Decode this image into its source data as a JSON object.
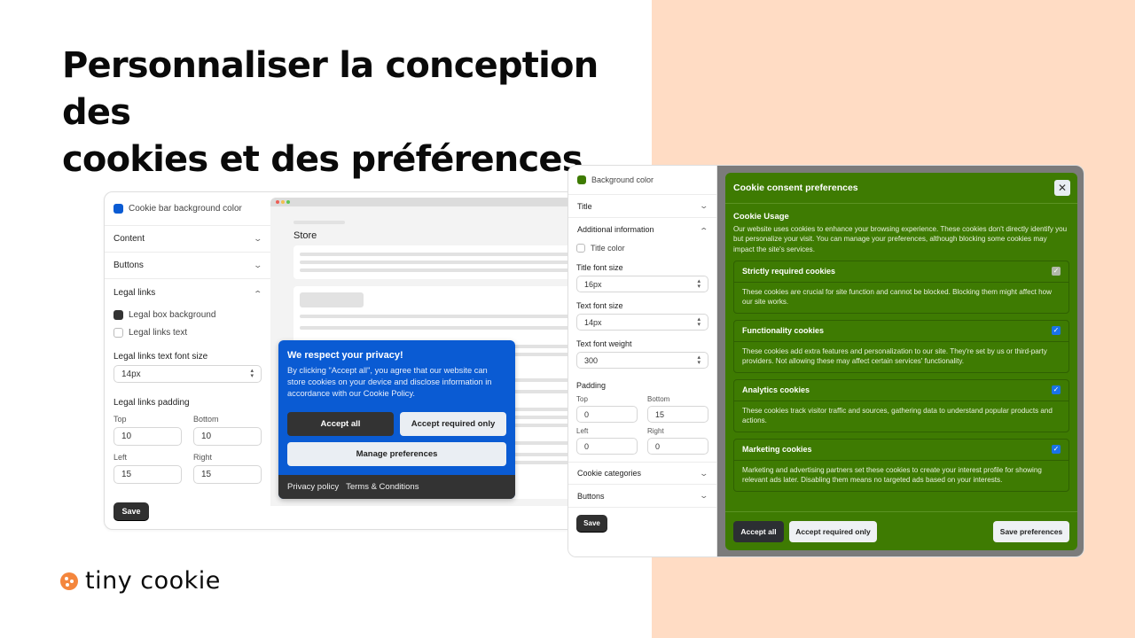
{
  "headline": {
    "line1": "Personnaliser la conception des",
    "line2": "cookies et des préférences"
  },
  "logo": {
    "text": "tiny cookie",
    "icon": "cookie-icon",
    "color": "#f4863d"
  },
  "colors": {
    "peach_background": "#ffdcc4",
    "cookie_bar_blue": "#0a5bd3",
    "modal_green": "#3e7b02",
    "dark_button": "#333333",
    "checkbox_blue": "#1a73e8"
  },
  "left_settings": {
    "bg_color_label": "Cookie bar background color",
    "bg_color_value": "#0a5bd3",
    "sections": {
      "content": "Content",
      "buttons": "Buttons",
      "legal_links": "Legal links"
    },
    "legal_box_background": {
      "label": "Legal box background",
      "color": "#333333"
    },
    "legal_links_text": {
      "label": "Legal links text"
    },
    "font_size": {
      "label": "Legal links text font size",
      "value": "14px"
    },
    "padding": {
      "label": "Legal links padding",
      "top_label": "Top",
      "top": "10",
      "bottom_label": "Bottom",
      "bottom": "10",
      "left_label": "Left",
      "left": "15",
      "right_label": "Right",
      "right": "15"
    },
    "save_label": "Save"
  },
  "preview": {
    "page_title": "Store",
    "cookie_bar": {
      "title": "We respect your privacy!",
      "text": "By clicking \"Accept all\", you agree that our website can store cookies on your device and disclose information in accordance with our Cookie Policy.",
      "accept_all": "Accept all",
      "accept_required": "Accept required only",
      "manage": "Manage preferences",
      "privacy_policy": "Privacy policy",
      "terms": "Terms & Conditions"
    }
  },
  "right_settings": {
    "bg_color_label": "Background color",
    "bg_color_value": "#3e7b02",
    "title_section": "Title",
    "additional_info": "Additional information",
    "title_color": "Title color",
    "title_font_size": {
      "label": "Title font size",
      "value": "16px"
    },
    "text_font_size": {
      "label": "Text font size",
      "value": "14px"
    },
    "text_font_weight": {
      "label": "Text font weight",
      "value": "300"
    },
    "padding": {
      "label": "Padding",
      "top_label": "Top",
      "top": "0",
      "bottom_label": "Bottom",
      "bottom": "15",
      "left_label": "Left",
      "left": "0",
      "right_label": "Right",
      "right": "0"
    },
    "cookie_categories": "Cookie categories",
    "buttons": "Buttons",
    "save_label": "Save"
  },
  "modal": {
    "title": "Cookie consent preferences",
    "close_icon": "close-icon",
    "usage_title": "Cookie Usage",
    "usage_text": "Our website uses cookies to enhance your browsing experience. These cookies don't directly identify you but personalize your visit. You can manage your preferences, although blocking some cookies may impact the site's services.",
    "categories": [
      {
        "name": "Strictly required cookies",
        "checked": true,
        "disabled": true,
        "description": "These cookies are crucial for site function and cannot be blocked. Blocking them might affect how our site works."
      },
      {
        "name": "Functionality cookies",
        "checked": true,
        "disabled": false,
        "description": "These cookies add extra features and personalization to our site. They're set by us or third-party providers. Not allowing these may affect certain services' functionality."
      },
      {
        "name": "Analytics cookies",
        "checked": true,
        "disabled": false,
        "description": "These cookies track visitor traffic and sources, gathering data to understand popular products and actions."
      },
      {
        "name": "Marketing cookies",
        "checked": true,
        "disabled": false,
        "description": "Marketing and advertising partners set these cookies to create your interest profile for showing relevant ads later. Disabling them means no targeted ads based on your interests."
      }
    ],
    "accept_all": "Accept all",
    "accept_required": "Accept required only",
    "save_preferences": "Save preferences"
  }
}
